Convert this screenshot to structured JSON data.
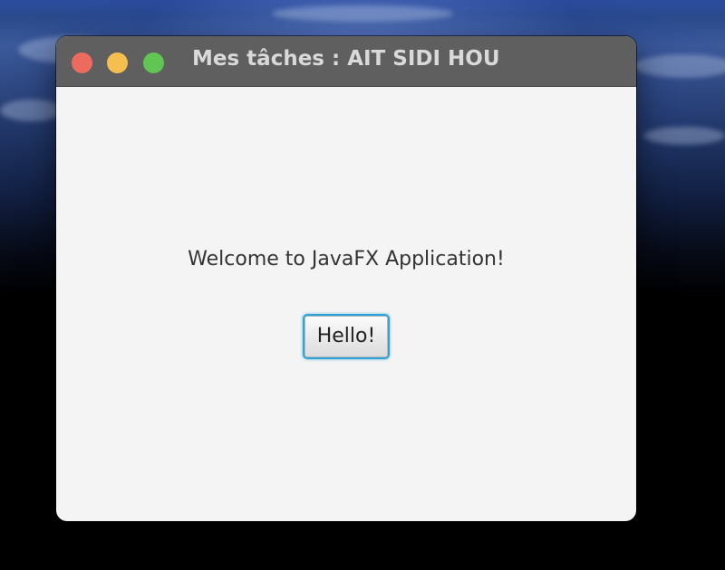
{
  "window": {
    "title": "Mes tâches : AIT SIDI HOU",
    "controls": {
      "close_color": "#ed6a5e",
      "minimize_color": "#f5bf4f",
      "zoom_color": "#61c554"
    }
  },
  "main": {
    "welcome_text": "Welcome to JavaFX Application!",
    "hello_button_label": "Hello!"
  },
  "colors": {
    "focus_ring": "#2ea3d6",
    "window_background": "#f4f4f4",
    "titlebar": "#5f5f5f"
  }
}
